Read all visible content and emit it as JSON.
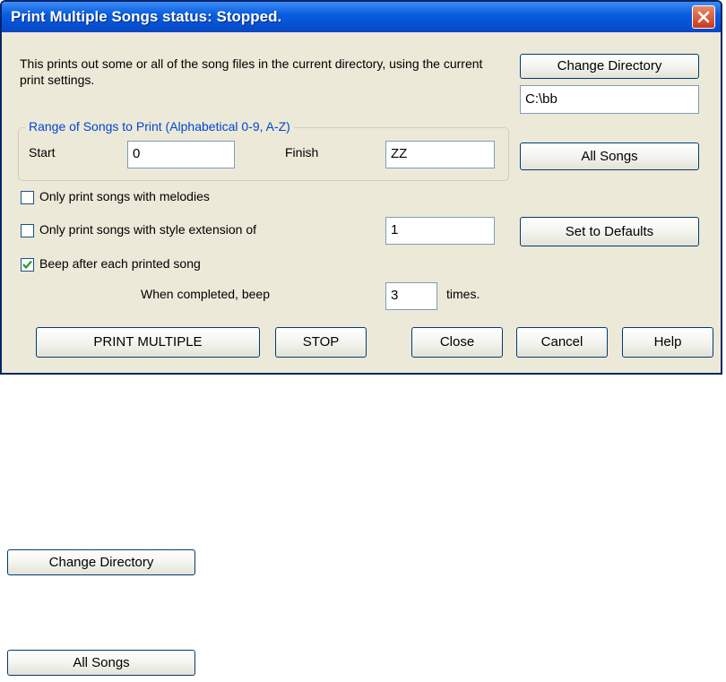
{
  "dialog": {
    "title": "Print Multiple Songs status: Stopped.",
    "description": "This prints out some or all of the song files in the current directory, using the current print settings.",
    "change_directory_label": "Change Directory",
    "directory_value": "C:\\bb",
    "range_group_title": "Range of Songs to Print  (Alphabetical 0-9, A-Z)",
    "start_label": "Start",
    "start_value": "0",
    "finish_label": "Finish",
    "finish_value": "ZZ",
    "all_songs_label": "All Songs",
    "melodies_only_label": "Only print songs with melodies",
    "melodies_only_checked": false,
    "style_ext_label": "Only print songs with style extension of",
    "style_ext_checked": false,
    "style_ext_value": "1",
    "set_defaults_label": "Set to Defaults",
    "beep_each_label": "Beep after each printed song",
    "beep_each_checked": true,
    "when_completed_label": "When completed, beep",
    "beep_count_value": "3",
    "times_label": "times.",
    "print_multiple_label": "PRINT MULTIPLE",
    "stop_label": "STOP",
    "close_label": "Close",
    "cancel_label": "Cancel",
    "help_label": "Help"
  },
  "standalone_buttons": {
    "change_directory_label": "Change Directory",
    "all_songs_label": "All Songs"
  },
  "icons": {
    "close": "close-icon",
    "checkmark": "checkmark-icon"
  },
  "colors": {
    "titlebar": "#0552d6",
    "dialog_bg": "#ece9d8",
    "group_title": "#0046d5",
    "close_button": "#c8381a",
    "checkmark": "#21a121"
  }
}
